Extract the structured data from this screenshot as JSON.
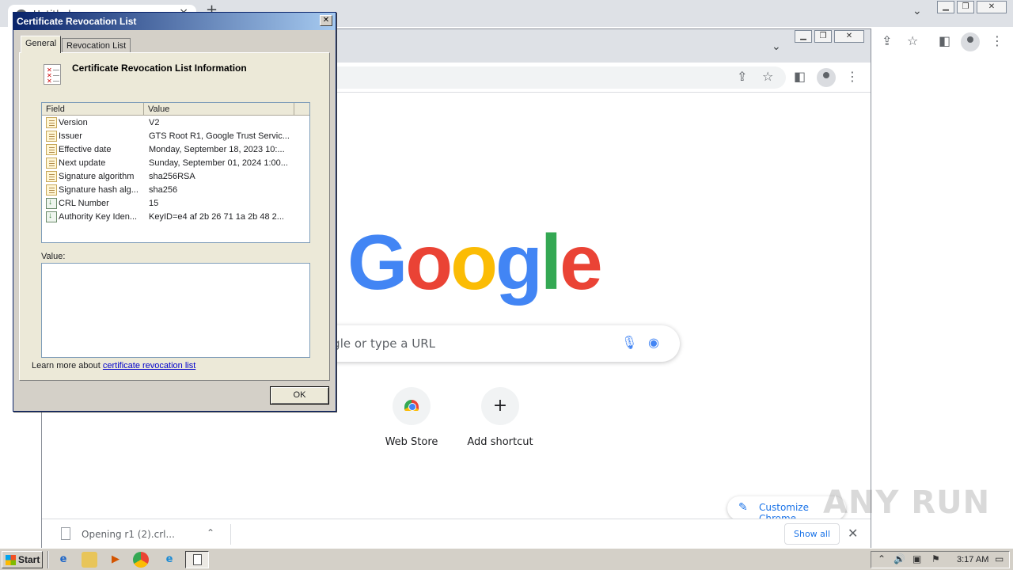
{
  "outer_browser": {
    "tab_title": "Untitled",
    "tab_close": "×",
    "new_tab": "+",
    "tab_search_icon": "chevron-down-icon"
  },
  "inner_browser": {
    "tab_search": "⌄",
    "google_logo": [
      "G",
      "o",
      "o",
      "g",
      "l",
      "e"
    ],
    "google_logo_colors": [
      "#4285f4",
      "#ea4335",
      "#fbbc05",
      "#4285f4",
      "#34a853",
      "#ea4335"
    ],
    "search_placeholder": "ogle or type a URL",
    "shortcuts": [
      {
        "label": "Web Store",
        "glyph": ""
      },
      {
        "label": "Add shortcut",
        "glyph": "+"
      }
    ],
    "customize_label": "Customize Chrome",
    "download": {
      "file_name": "Opening r1 (2).crl...",
      "chevron": "⌃",
      "show_all": "Show all",
      "close": "✕"
    }
  },
  "watermark": "ANY RUN",
  "dialog": {
    "title": "Certificate Revocation List",
    "close": "✕",
    "tabs": [
      "General",
      "Revocation List"
    ],
    "heading": "Certificate Revocation List Information",
    "columns": [
      "Field",
      "Value"
    ],
    "rows": [
      {
        "field": "Version",
        "value": "V2",
        "icon": "document-icon"
      },
      {
        "field": "Issuer",
        "value": "GTS Root R1, Google Trust Servic...",
        "icon": "document-icon"
      },
      {
        "field": "Effective date",
        "value": "Monday, September 18, 2023 10:...",
        "icon": "document-icon"
      },
      {
        "field": "Next update",
        "value": "Sunday, September 01, 2024 1:00...",
        "icon": "document-icon"
      },
      {
        "field": "Signature algorithm",
        "value": "sha256RSA",
        "icon": "document-icon"
      },
      {
        "field": "Signature hash alg...",
        "value": "sha256",
        "icon": "document-icon"
      },
      {
        "field": "CRL Number",
        "value": "15",
        "icon": "extension-icon"
      },
      {
        "field": "Authority Key Iden...",
        "value": "KeyID=e4 af 2b 26 71 1a 2b 48 2...",
        "icon": "extension-icon"
      }
    ],
    "value_label": "Value:",
    "learn_more_prefix": "Learn more about ",
    "learn_more_link": "certificate revocation list",
    "ok_label": "OK"
  },
  "taskbar": {
    "start_label": "Start",
    "clock": "3:17 AM"
  }
}
